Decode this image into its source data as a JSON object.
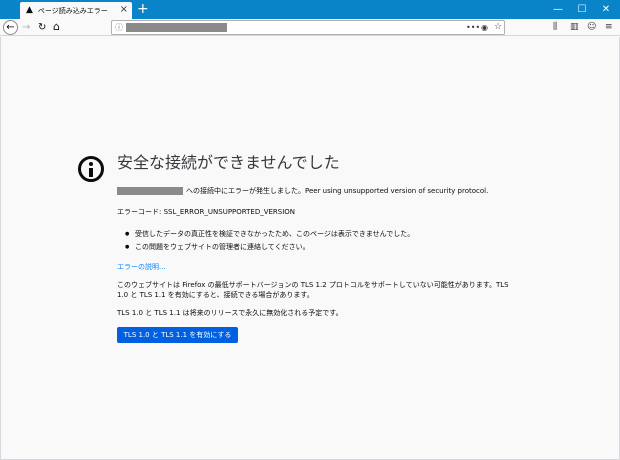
{
  "browser": {
    "tab": {
      "icon": "warning-icon",
      "title": "ページ読み込みエラー",
      "close": "×"
    },
    "new_tab": "+",
    "window_controls": {
      "minimize": "—",
      "maximize": "☐",
      "close": "✕"
    },
    "nav": {
      "back": "←",
      "forward": "→",
      "reload": "↻",
      "home": "⌂"
    },
    "url_bar": {
      "info_icon": "ⓘ",
      "page_actions": "•••",
      "pocket": "◉",
      "bookmark_star": "☆"
    },
    "toolbar": {
      "library": "⫼",
      "sidebar": "▥",
      "account": "☺",
      "menu": "≡"
    }
  },
  "error_page": {
    "title": "安全な接続ができませんでした",
    "description": "への接続中にエラーが発生しました。Peer using unsupported version of security protocol.",
    "error_code": "エラーコード: SSL_ERROR_UNSUPPORTED_VERSION",
    "bullets": [
      "受信したデータの真正性を検証できなかったため、このページは表示できませんでした。",
      "この問題をウェブサイトの管理者に連絡してください。"
    ],
    "learn_more": "エラーの説明...",
    "paragraph1": "このウェブサイトは Firefox の最低サポートバージョンの TLS 1.2 プロトコルをサポートしていない可能性があります。TLS 1.0 と TLS 1.1 を有効にすると、接続できる場合があります。",
    "paragraph2": "TLS 1.0 と TLS 1.1 は将来のリリースで永久に無効化される予定です。",
    "button_label": "TLS 1.0 と TLS 1.1 を有効にする"
  },
  "colors": {
    "titlebar": "#0a84c8",
    "button": "#0060df",
    "link": "#0a84ff",
    "page_bg": "#f9f9fa"
  }
}
